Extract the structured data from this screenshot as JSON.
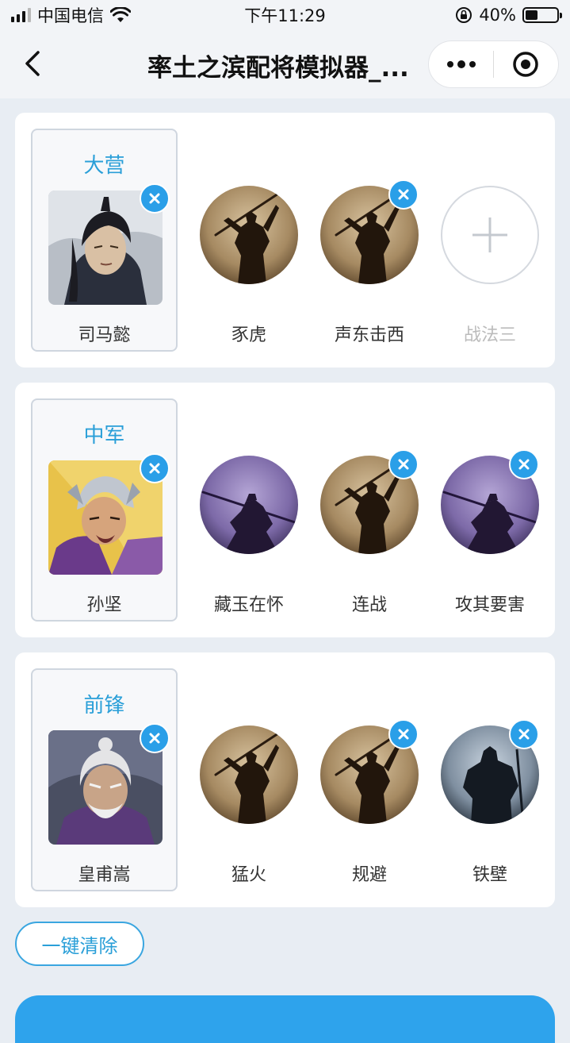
{
  "status_bar": {
    "carrier": "中国电信",
    "time": "下午11:29",
    "battery": "40%",
    "battery_level": 0.4
  },
  "nav": {
    "title": "率土之滨配将模拟器_..."
  },
  "cards": [
    {
      "position": "大营",
      "general": "司马懿",
      "skills": [
        {
          "name": "豕虎",
          "removable": false
        },
        {
          "name": "声东击西",
          "removable": true
        },
        {
          "name": "战法三",
          "empty": true
        }
      ]
    },
    {
      "position": "中军",
      "general": "孙坚",
      "skills": [
        {
          "name": "藏玉在怀",
          "removable": false
        },
        {
          "name": "连战",
          "removable": true
        },
        {
          "name": "攻其要害",
          "removable": true
        }
      ]
    },
    {
      "position": "前锋",
      "general": "皇甫嵩",
      "skills": [
        {
          "name": "猛火",
          "removable": false
        },
        {
          "name": "规避",
          "removable": true
        },
        {
          "name": "铁壁",
          "removable": true
        }
      ]
    }
  ],
  "actions": {
    "clear_all": "一键清除"
  },
  "icons": {
    "back": "chevron-left-icon",
    "more": "more-dots-icon",
    "close_app": "target-circle-icon",
    "remove": "close-x-icon",
    "add": "plus-icon"
  },
  "colors": {
    "accent": "#2a9fd8",
    "badge": "#2a9fe8",
    "background": "#e8edf3"
  }
}
